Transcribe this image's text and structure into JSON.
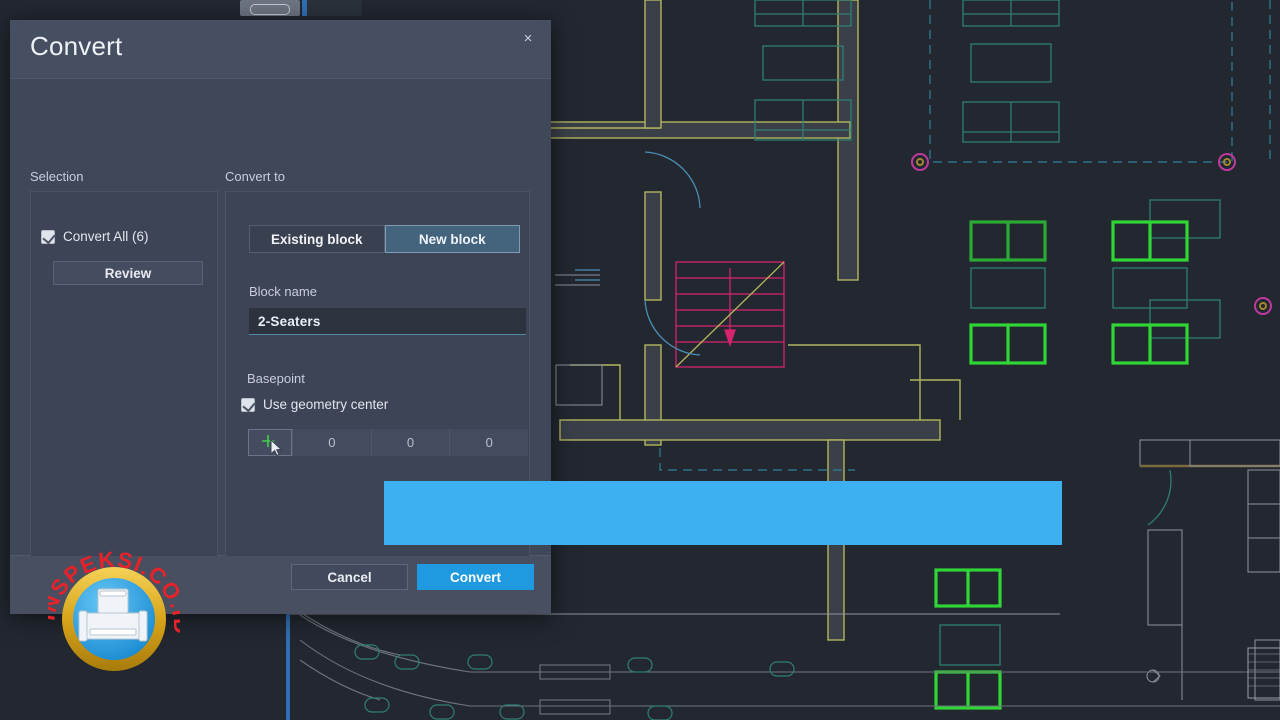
{
  "dialog": {
    "title": "Convert",
    "close_label": "×",
    "selection": {
      "group_label": "Selection",
      "convert_all_label": "Convert All (6)",
      "convert_all_checked": true,
      "review_label": "Review"
    },
    "convert_to": {
      "group_label": "Convert to",
      "tabs": [
        {
          "label": "Existing block",
          "active": false
        },
        {
          "label": "New block",
          "active": true
        }
      ],
      "block_name_label": "Block name",
      "block_name_value": "2-Seaters",
      "block_name_placeholder": "Block name",
      "basepoint_label": "Basepoint",
      "use_geometry_center_label": "Use geometry center",
      "use_geometry_center_checked": true,
      "pick_point_icon": "crosshair-pick-point-icon",
      "basepoint_x": "0",
      "basepoint_y": "0",
      "basepoint_z": "0"
    },
    "footer": {
      "cancel_label": "Cancel",
      "convert_label": "Convert"
    }
  },
  "overlay": {
    "blue_bar_color": "#3cb0f0"
  },
  "watermark": {
    "text": "INSPEKSI.CO.ID",
    "text_color": "#e8222a",
    "ring_color": "#e0a81c",
    "disc_color": "#2ba3e8",
    "icon": "pipe-tee-fitting-icon"
  },
  "canvas": {
    "background_color": "#222730",
    "wall_color": "#b2b65e",
    "furniture_color": "#2f7f74",
    "selected_color": "#2fd636",
    "stair_color": "#d6246e",
    "door_color": "#4a8fb5",
    "grid_marker_color": "#c0399e",
    "dim_color": "#8e939e"
  },
  "colors": {
    "dialog_bg": "#3f4859",
    "titlebar_bg": "#464f61",
    "panel_bg": "#3c4456",
    "accent_blue": "#1f9ae0",
    "tab_active_bg": "#44637c",
    "input_bg": "#2c323e",
    "input_underline": "#4f8ea0"
  }
}
